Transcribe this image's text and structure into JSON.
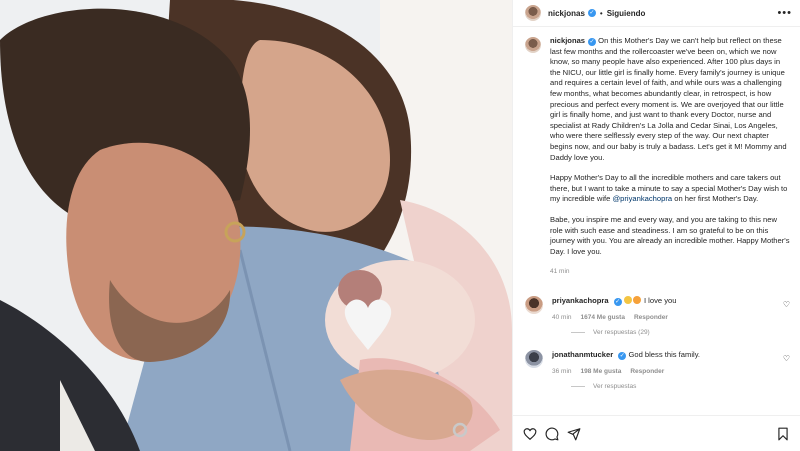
{
  "post": {
    "username": "nickjonas",
    "separator": "•",
    "follow_label": "Siguiendo",
    "more_label": "•••",
    "caption_paragraphs": [
      "On this Mother's Day we can't help but reflect on these last few months and the rollercoaster we've been on, which we now know, so many people have also experienced. After 100 plus days in the NICU, our little girl is finally home. Every family's journey is unique and requires a certain level of faith, and while ours was a challenging few months, what becomes abundantly clear, in retrospect, is how precious and perfect every moment is. We are overjoyed that our little girl is finally home, and just want to thank every Doctor, nurse and specialist at Rady Children's La Jolla and Cedar Sinai, Los Angeles, who were there selflessly every step of the way. Our next chapter begins now, and our baby is truly a badass. Let's get it M! Mommy and Daddy love you."
    ],
    "caption_p2_before": "Happy Mother's Day to all the incredible mothers and care takers out there, but I want to take a minute to say a special Mother's Day wish to my incredible wife ",
    "caption_p2_mention": "@priyankachopra",
    "caption_p2_after": " on her first Mother's Day.",
    "caption_p3": "Babe, you inspire me and every way, and you are taking to this new role with such ease and steadiness. I am so grateful to be on this journey with you. You are already an incredible mother. Happy Mother's Day. I love you.",
    "time_ago": "41 min"
  },
  "comments": [
    {
      "username": "priyankachopra",
      "text": "I love you",
      "time": "40 min",
      "likes": "1674 Me gusta",
      "reply_label": "Responder",
      "view_replies": "Ver respuestas (29)"
    },
    {
      "username": "jonathanmtucker",
      "text": "God bless this family.",
      "time": "36 min",
      "likes": "198 Me gusta",
      "reply_label": "Responder",
      "view_replies": "Ver respuestas"
    }
  ],
  "colors": {
    "verified": "#3897f0",
    "mention": "#00376b",
    "meta": "#8e8e8e"
  },
  "icons": [
    "verified-icon",
    "heart-icon",
    "comment-icon",
    "share-icon",
    "bookmark-icon",
    "more-icon"
  ]
}
